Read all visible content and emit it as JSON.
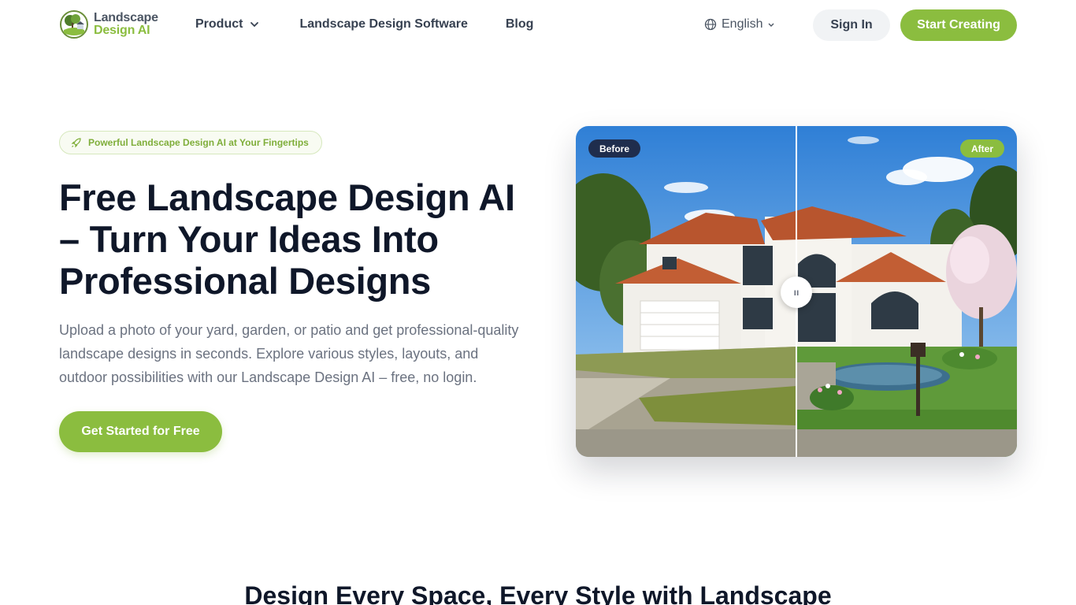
{
  "header": {
    "logo_line1": "Landscape",
    "logo_line2": "Design AI",
    "nav": {
      "product": "Product",
      "software": "Landscape Design Software",
      "blog": "Blog"
    },
    "language": "English",
    "sign_in": "Sign In",
    "start_creating": "Start Creating"
  },
  "hero": {
    "badge": "Powerful Landscape Design AI at Your Fingertips",
    "headline": "Free Landscape Design AI – Turn Your Ideas Into Professional Designs",
    "subtext": "Upload a photo of your yard, garden, or patio and get professional-quality landscape designs in seconds. Explore various styles, layouts, and outdoor possibilities with our Landscape Design AI – free, no login.",
    "cta": "Get Started for Free"
  },
  "compare": {
    "before_label": "Before",
    "after_label": "After",
    "handle_glyph": "ıı"
  },
  "section": {
    "title": "Design Every Space, Every Style with Landscape"
  },
  "colors": {
    "brand_green": "#8bbd3f",
    "navy": "#1f2d4d",
    "text_dark": "#0f1729"
  }
}
